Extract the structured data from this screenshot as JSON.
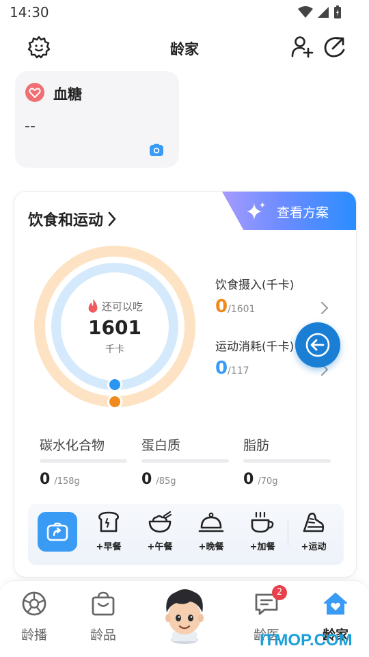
{
  "status_bar": {
    "time": "14:30"
  },
  "header": {
    "title": "龄家"
  },
  "blood_sugar": {
    "title": "血糖",
    "value": "--"
  },
  "diet": {
    "title": "饮食和运动",
    "plan_button": "查看方案",
    "ring": {
      "remaining_label": "还可以吃",
      "remaining_value": "1601",
      "unit": "千卡",
      "intake_fraction": 0,
      "exercise_fraction": 0
    },
    "intake": {
      "label": "饮食摄入(千卡)",
      "value": "0",
      "total": "/1601"
    },
    "exercise": {
      "label": "运动消耗(千卡)",
      "value": "0",
      "total": "/117"
    },
    "macros": [
      {
        "name": "碳水化合物",
        "value": "0",
        "total": "/158g"
      },
      {
        "name": "蛋白质",
        "value": "0",
        "total": "/85g"
      },
      {
        "name": "脂肪",
        "value": "0",
        "total": "/70g"
      }
    ],
    "meals": [
      {
        "label": "+早餐",
        "icon": "toast-icon"
      },
      {
        "label": "+午餐",
        "icon": "bowl-icon"
      },
      {
        "label": "+晚餐",
        "icon": "cloche-icon"
      },
      {
        "label": "+加餐",
        "icon": "cup-icon"
      },
      {
        "label": "+运动",
        "icon": "shoe-icon"
      }
    ]
  },
  "bottom_nav": [
    {
      "label": "龄播",
      "icon": "aperture-icon"
    },
    {
      "label": "龄品",
      "icon": "shopping-bag-icon"
    },
    {
      "label": "",
      "icon": "avatar-icon"
    },
    {
      "label": "龄医",
      "icon": "chat-icon",
      "badge": "2"
    },
    {
      "label": "龄家",
      "icon": "home-heart-icon",
      "active": true
    }
  ],
  "watermark": "ITMOP.COM",
  "colors": {
    "accent": "#1a7fd4",
    "intake": "#f08a1c",
    "exercise": "#3a9bf5",
    "ring_outer": "#fde3c4",
    "ring_inner": "#d4eafc"
  }
}
